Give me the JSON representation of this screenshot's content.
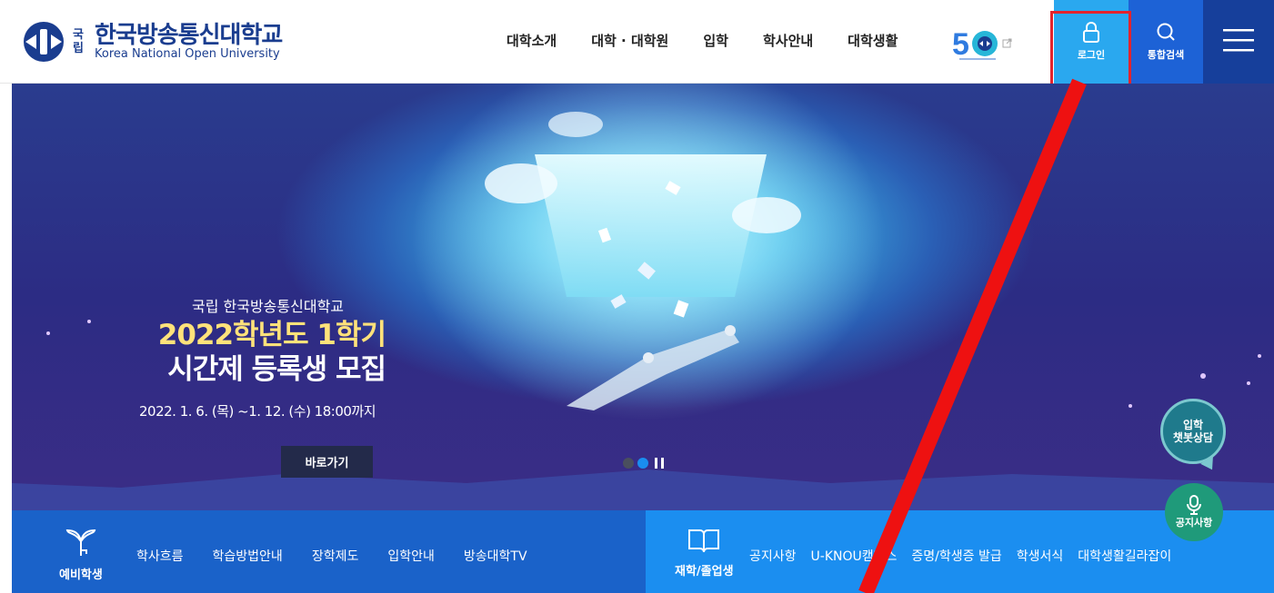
{
  "header": {
    "logo": {
      "small": "국\n립",
      "name_kr": "한국방송통신대학교",
      "name_en": "Korea National Open University"
    },
    "nav": [
      "대학소개",
      "대학 · 대학원",
      "입학",
      "학사안내",
      "대학생활"
    ],
    "login_label": "로그인",
    "search_label": "통합검색"
  },
  "hero": {
    "subtitle": "국립 한국방송통신대학교",
    "title_line1_hl": "2022학년도 1학기",
    "title_line2": "시간제 등록생 모집",
    "date": "2022. 1. 6. (목) ~1. 12. (수) 18:00까지",
    "button": "바로가기"
  },
  "floating": {
    "chatbot_line1": "입학",
    "chatbot_line2": "챗봇상담",
    "notice": "공지사항"
  },
  "bottom": {
    "prospective": {
      "label": "예비학생",
      "links": [
        "학사흐름",
        "학습방법안내",
        "장학제도",
        "입학안내",
        "방송대학TV"
      ]
    },
    "current": {
      "label": "재학/졸업생",
      "links": [
        "공지사항",
        "U-KNOU캠퍼스",
        "증명/학생증 발급",
        "학생서식",
        "대학생활길라잡이"
      ]
    }
  },
  "colors": {
    "login_bg": "#2aa8ef",
    "search_bg": "#1d62d6",
    "menu_bg": "#163f9b",
    "annotation_red": "#e3232c"
  }
}
